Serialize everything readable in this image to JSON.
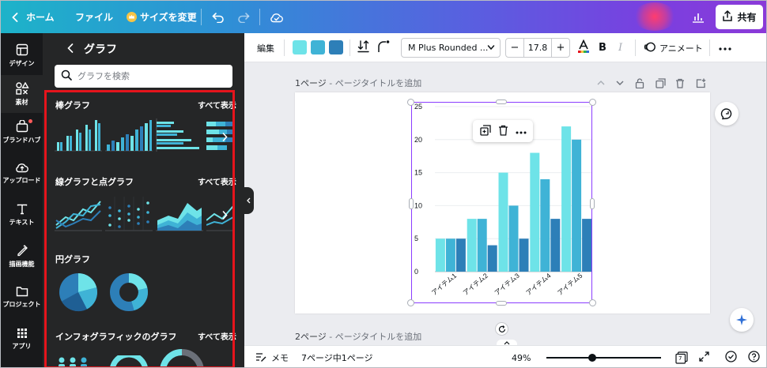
{
  "topbar": {
    "home_label": "ホーム",
    "file_label": "ファイル",
    "resize_label": "サイズを変更",
    "share_label": "共有"
  },
  "rail": {
    "items": [
      {
        "label": "デザイン",
        "icon": "design-icon"
      },
      {
        "label": "素材",
        "icon": "elements-icon"
      },
      {
        "label": "ブランドハブ",
        "icon": "brand-icon"
      },
      {
        "label": "アップロード",
        "icon": "upload-icon"
      },
      {
        "label": "テキスト",
        "icon": "text-icon"
      },
      {
        "label": "描画機能",
        "icon": "draw-icon"
      },
      {
        "label": "プロジェクト",
        "icon": "folder-icon"
      },
      {
        "label": "アプリ",
        "icon": "apps-icon"
      }
    ]
  },
  "panel": {
    "title": "グラフ",
    "search_placeholder": "グラフを検索",
    "show_all": "すべて表示",
    "sections": [
      {
        "title": "棒グラフ"
      },
      {
        "title": "線グラフと点グラフ"
      },
      {
        "title": "円グラフ"
      },
      {
        "title": "インフォグラフィックのグラフ"
      }
    ]
  },
  "toolbar": {
    "edit_label": "編集",
    "swatches": [
      "#6ee3e8",
      "#3fb3d6",
      "#2d7fb8"
    ],
    "font_name": "M Plus Rounded ...",
    "font_size": "17.8",
    "animate_label": "アニメート",
    "bold_label": "B",
    "italic_label": "I"
  },
  "canvas": {
    "page1_label": "1ページ",
    "page1_sub": " - ページタイトルを追加",
    "page2_label": "2ページ",
    "page2_sub": " - ページタイトルを追加"
  },
  "bottombar": {
    "notes_label": "メモ",
    "page_count": "7ページ中1ページ",
    "zoom": "49%",
    "zoom_fraction": 0.4,
    "pages_badge": "7"
  },
  "chart_data": {
    "type": "bar",
    "categories": [
      "アイテム1",
      "アイテム2",
      "アイテム3",
      "アイテム4",
      "アイテム5"
    ],
    "series": [
      {
        "values": [
          5,
          8,
          15,
          18,
          22
        ],
        "color": "#6ee3e8"
      },
      {
        "values": [
          5,
          8,
          10,
          14,
          20
        ],
        "color": "#3fb3d6"
      },
      {
        "values": [
          5,
          4,
          5,
          8,
          8
        ],
        "color": "#2d7fb8"
      }
    ],
    "ylim": [
      0,
      25
    ],
    "yticks": [
      0,
      5,
      10,
      15,
      20,
      25
    ],
    "grid": true
  }
}
